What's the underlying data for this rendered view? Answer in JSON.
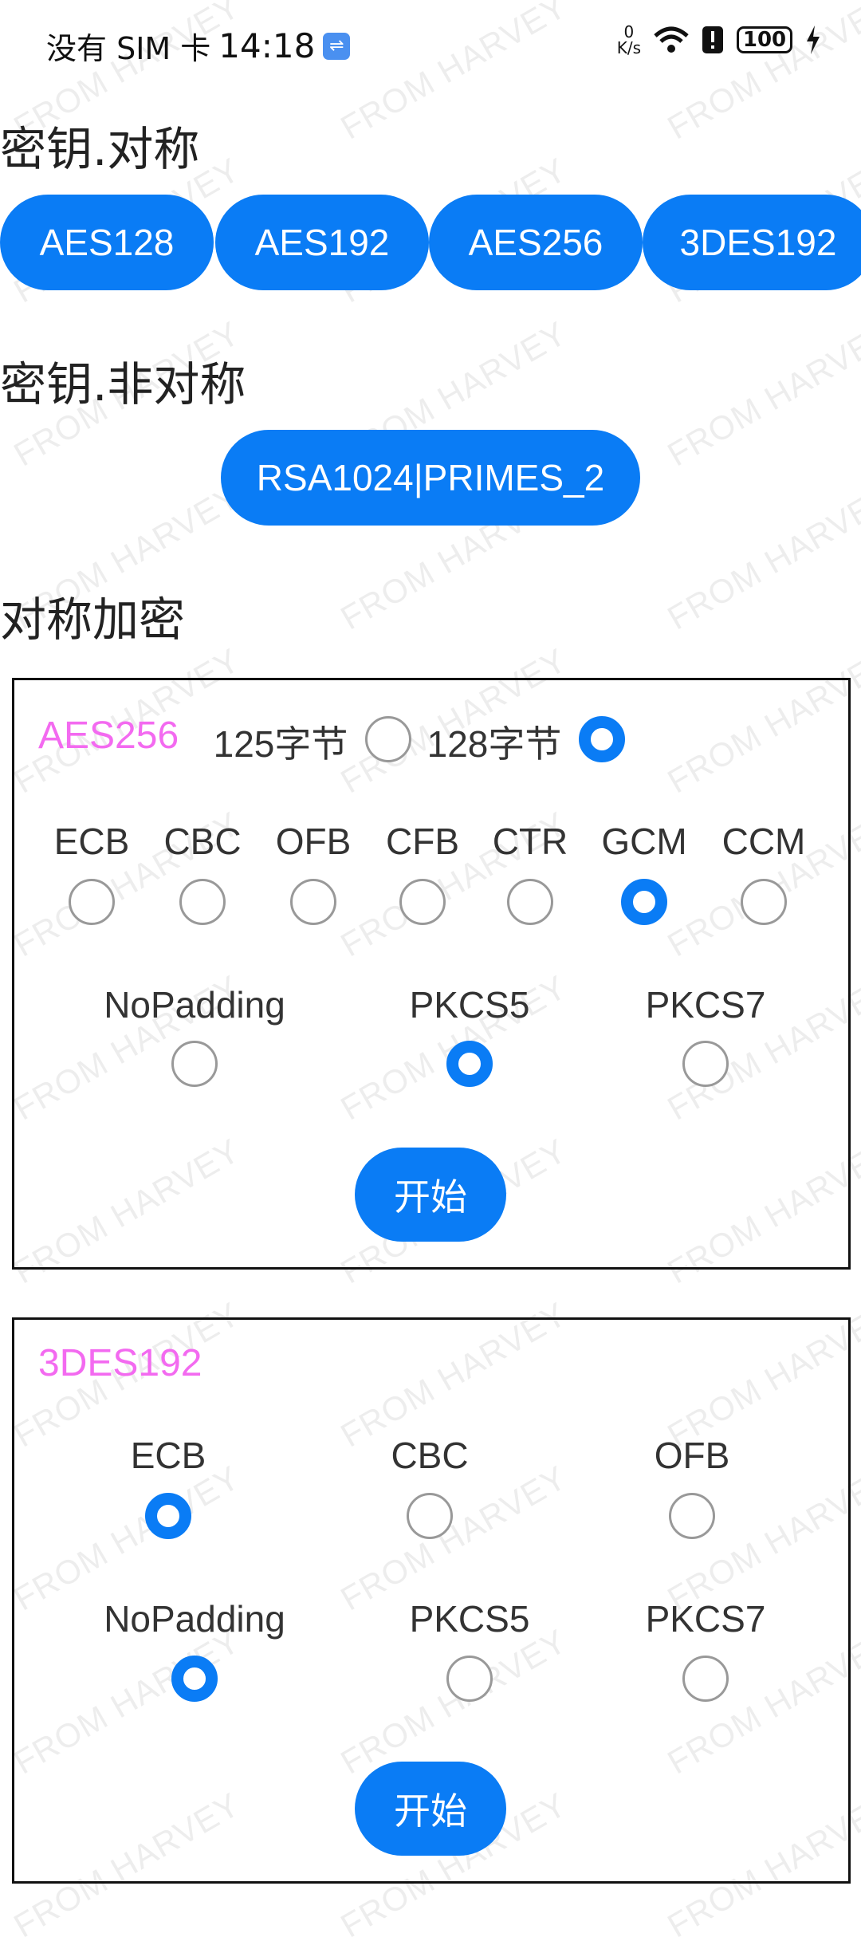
{
  "status_bar": {
    "carrier": "没有 SIM 卡",
    "time": "14:18",
    "net_speed_value": "0",
    "net_speed_unit": "K/s",
    "battery": "100"
  },
  "watermark": "FROM HARVEY",
  "symmetric_keys": {
    "title": "密钥.对称",
    "buttons": [
      "AES128",
      "AES192",
      "AES256",
      "3DES192"
    ]
  },
  "asymmetric_keys": {
    "title": "密钥.非对称",
    "button": "RSA1024|PRIMES_2"
  },
  "symmetric_encrypt": {
    "title": "对称加密",
    "aes_card": {
      "title": "AES256",
      "iv_options": [
        {
          "label": "125字节",
          "checked": false
        },
        {
          "label": "128字节",
          "checked": true
        }
      ],
      "modes": [
        {
          "label": "ECB",
          "checked": false
        },
        {
          "label": "CBC",
          "checked": false
        },
        {
          "label": "OFB",
          "checked": false
        },
        {
          "label": "CFB",
          "checked": false
        },
        {
          "label": "CTR",
          "checked": false
        },
        {
          "label": "GCM",
          "checked": true
        },
        {
          "label": "CCM",
          "checked": false
        }
      ],
      "paddings": [
        {
          "label": "NoPadding",
          "checked": false
        },
        {
          "label": "PKCS5",
          "checked": true
        },
        {
          "label": "PKCS7",
          "checked": false
        }
      ],
      "start_label": "开始"
    },
    "des_card": {
      "title": "3DES192",
      "modes": [
        {
          "label": "ECB",
          "checked": true
        },
        {
          "label": "CBC",
          "checked": false
        },
        {
          "label": "OFB",
          "checked": false
        }
      ],
      "paddings": [
        {
          "label": "NoPadding",
          "checked": true
        },
        {
          "label": "PKCS5",
          "checked": false
        },
        {
          "label": "PKCS7",
          "checked": false
        }
      ],
      "start_label": "开始"
    }
  },
  "colors": {
    "accent": "#0a7cf5",
    "card_title": "#f36af0"
  }
}
